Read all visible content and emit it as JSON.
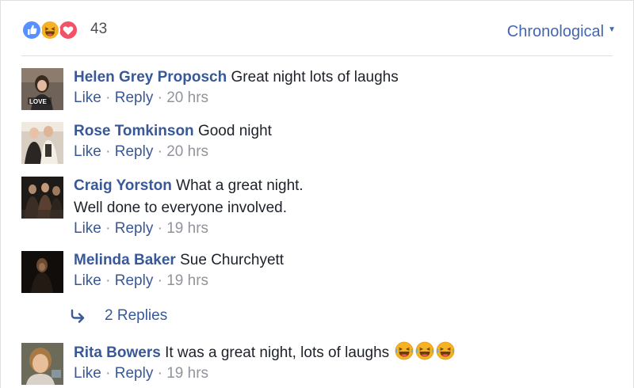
{
  "reactions": {
    "icons": [
      "like-icon",
      "haha-icon",
      "love-icon"
    ],
    "count": "43",
    "colors": {
      "like": "#5890ff",
      "haha": "#f7b125",
      "love": "#f25268"
    }
  },
  "sort": {
    "label": "Chronological",
    "caret": "▼"
  },
  "actions": {
    "like": "Like",
    "reply": "Reply",
    "sep": "·"
  },
  "comments": [
    {
      "author": "Helen Grey Proposch",
      "text": "Great night lots of laughs",
      "time": "20 hrs"
    },
    {
      "author": "Rose Tomkinson",
      "text": "Good night",
      "time": "20 hrs"
    },
    {
      "author": "Craig Yorston",
      "text": "What a great night.",
      "text2": "Well done to everyone involved.",
      "time": "19 hrs"
    },
    {
      "author": "Melinda Baker",
      "text": "Sue Churchyett",
      "time": "19 hrs"
    },
    {
      "author": "Rita Bowers",
      "text": "It was a great night, lots of laughs",
      "emoji": "laughing-emoji",
      "time": "19 hrs"
    }
  ],
  "replies": {
    "label": "2 Replies"
  },
  "colors": {
    "link": "#385898",
    "meta": "#90949c",
    "accent": "#4267b2"
  }
}
